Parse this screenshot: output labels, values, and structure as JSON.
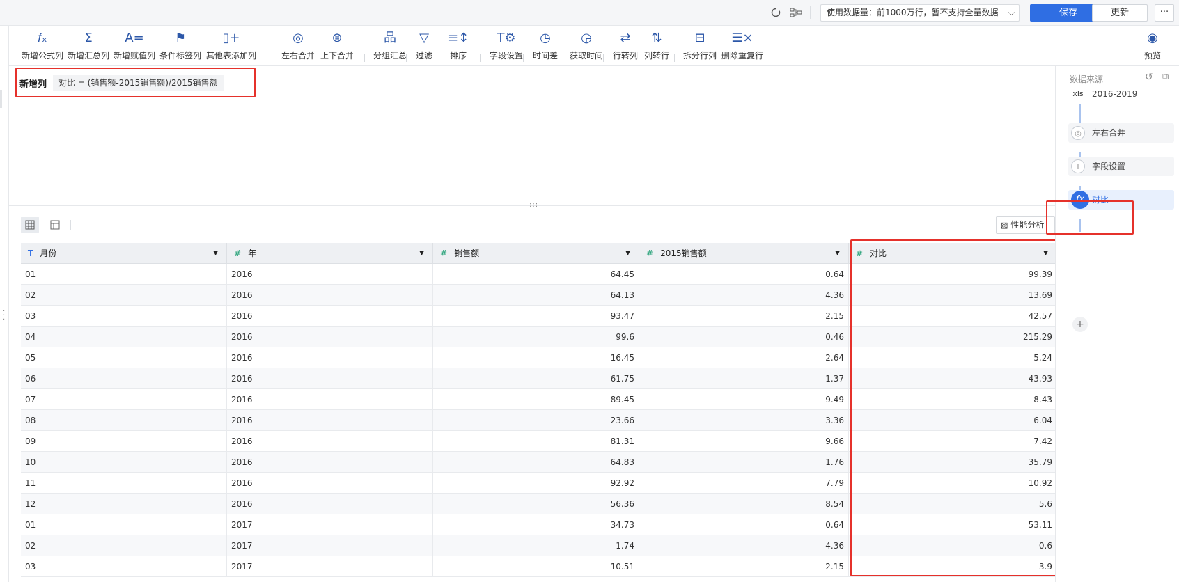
{
  "topbar": {
    "data_size_label": "使用数据量：前1000万行，暂不支持全量数据",
    "save_label": "保存",
    "update_label": "更新",
    "more_label": "···"
  },
  "toolbar": {
    "items": [
      {
        "icon": "fx-icon",
        "glyph": "𝑓ₓ",
        "label": "新增公式列"
      },
      {
        "icon": "sigma-icon",
        "glyph": "Σ",
        "label": "新增汇总列"
      },
      {
        "icon": "assign-icon",
        "glyph": "A=",
        "label": "新增赋值列"
      },
      {
        "icon": "flag-icon",
        "glyph": "⚑",
        "label": "条件标签列"
      },
      {
        "icon": "add-column-icon",
        "glyph": "▯+",
        "label": "其他表添加列"
      },
      {
        "icon": "join-lr-icon",
        "glyph": "◎",
        "label": "左右合并"
      },
      {
        "icon": "join-ud-icon",
        "glyph": "⊜",
        "label": "上下合并"
      },
      {
        "icon": "group-icon",
        "glyph": "品",
        "label": "分组汇总"
      },
      {
        "icon": "filter-icon",
        "glyph": "▽",
        "label": "过滤"
      },
      {
        "icon": "sort-icon",
        "glyph": "≡↕",
        "label": "排序"
      },
      {
        "icon": "field-settings-icon",
        "glyph": "T⚙",
        "label": "字段设置"
      },
      {
        "icon": "time-diff-icon",
        "glyph": "◷",
        "label": "时间差"
      },
      {
        "icon": "get-time-icon",
        "glyph": "◶",
        "label": "获取时间"
      },
      {
        "icon": "row-to-col-icon",
        "glyph": "⇄",
        "label": "行转列"
      },
      {
        "icon": "col-to-row-icon",
        "glyph": "⇅",
        "label": "列转行"
      },
      {
        "icon": "split-row-icon",
        "glyph": "⊟",
        "label": "拆分行列"
      },
      {
        "icon": "dedupe-icon",
        "glyph": "☰×",
        "label": "删除重复行"
      },
      {
        "icon": "preview-icon",
        "glyph": "◉",
        "label": "预览"
      }
    ]
  },
  "formula": {
    "label": "新增列",
    "expression": "对比 = (销售额-2015销售额)/2015销售额"
  },
  "view": {
    "perf_label": "性能分析"
  },
  "table": {
    "columns": [
      {
        "type": "text",
        "type_glyph": "T",
        "name": "月份"
      },
      {
        "type": "number",
        "type_glyph": "#",
        "name": "年"
      },
      {
        "type": "number",
        "type_glyph": "#",
        "name": "销售额"
      },
      {
        "type": "number",
        "type_glyph": "#",
        "name": "2015销售额"
      },
      {
        "type": "number",
        "type_glyph": "#",
        "name": "对比"
      }
    ],
    "rows": [
      [
        "01",
        "2016",
        "64.45",
        "0.64",
        "99.39"
      ],
      [
        "02",
        "2016",
        "64.13",
        "4.36",
        "13.69"
      ],
      [
        "03",
        "2016",
        "93.47",
        "2.15",
        "42.57"
      ],
      [
        "04",
        "2016",
        "99.6",
        "0.46",
        "215.29"
      ],
      [
        "05",
        "2016",
        "16.45",
        "2.64",
        "5.24"
      ],
      [
        "06",
        "2016",
        "61.75",
        "1.37",
        "43.93"
      ],
      [
        "07",
        "2016",
        "89.45",
        "9.49",
        "8.43"
      ],
      [
        "08",
        "2016",
        "23.66",
        "3.36",
        "6.04"
      ],
      [
        "09",
        "2016",
        "81.31",
        "9.66",
        "7.42"
      ],
      [
        "10",
        "2016",
        "64.83",
        "1.76",
        "35.79"
      ],
      [
        "11",
        "2016",
        "92.92",
        "7.79",
        "10.92"
      ],
      [
        "12",
        "2016",
        "56.36",
        "8.54",
        "5.6"
      ],
      [
        "01",
        "2017",
        "34.73",
        "0.64",
        "53.11"
      ],
      [
        "02",
        "2017",
        "1.74",
        "4.36",
        "-0.6"
      ],
      [
        "03",
        "2017",
        "10.51",
        "2.15",
        "3.9"
      ]
    ]
  },
  "right_panel": {
    "title": "数据来源",
    "steps": [
      {
        "kind": "source",
        "icon": "xls-icon",
        "glyph": "xls",
        "label": "2016-2019"
      },
      {
        "kind": "gray",
        "icon": "join-lr-icon",
        "glyph": "◎",
        "label": "左右合并"
      },
      {
        "kind": "gray",
        "icon": "field-settings-icon",
        "glyph": "T",
        "label": "字段设置"
      },
      {
        "kind": "active",
        "icon": "fx-icon",
        "glyph": "fx",
        "label": "对比"
      }
    ],
    "add_label": "+"
  },
  "colors": {
    "accent": "#2f6ee3",
    "highlight": "#e5312b",
    "number_type": "#2aa37a"
  }
}
